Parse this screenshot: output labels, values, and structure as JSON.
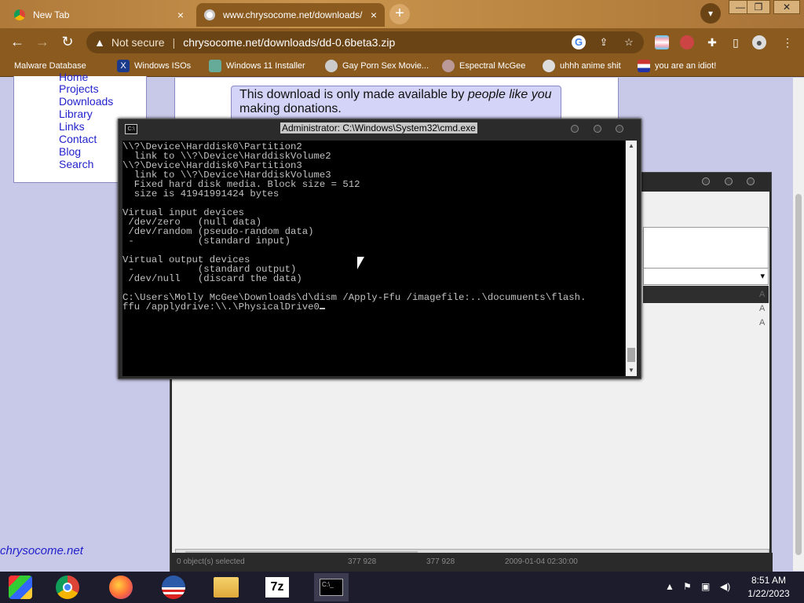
{
  "browser": {
    "tabs": [
      {
        "label": "New Tab",
        "close": "×",
        "active": false
      },
      {
        "label": "www.chrysocome.net/downloads/",
        "close": "×",
        "active": true
      }
    ],
    "new_tab": "+",
    "window_controls": [
      "—",
      "❐",
      "✕"
    ],
    "address": {
      "security_label": "Not secure",
      "url": "chrysocome.net/downloads/dd-0.6beta3.zip"
    },
    "bookmarks": [
      {
        "label": "Malware Database",
        "icon": "globe-icon"
      },
      {
        "label": "Windows ISOs",
        "icon": "x-icon"
      },
      {
        "label": "Windows 11 Installer",
        "icon": "image-icon"
      },
      {
        "label": "Gay Porn Sex Movie...",
        "icon": "avatar-icon"
      },
      {
        "label": "Espectral McGee",
        "icon": "avatar-icon"
      },
      {
        "label": "uhhh anime shit",
        "icon": "avatar-icon"
      },
      {
        "label": "you are an idiot!",
        "icon": "flag-icon"
      }
    ]
  },
  "page": {
    "nav_links": [
      "Home",
      "Projects",
      "Downloads",
      "Library",
      "Links",
      "Contact",
      "Blog",
      "Search"
    ],
    "donation_text_prefix": "This download is only made available by ",
    "donation_text_em": "people like you",
    "donation_text_suffix": "making donations.",
    "site_link": "chrysocome.net"
  },
  "bg_window": {
    "column_letters": [
      "A",
      "A",
      "A"
    ],
    "status_items": [
      "0 object(s) selected",
      "377 928",
      "377 928",
      "2009-01-04 02:30:00"
    ]
  },
  "cmd": {
    "title": "Administrator: C:\\Windows\\System32\\cmd.exe",
    "lines": [
      "\\\\?\\Device\\Harddisk0\\Partition2",
      "  link to \\\\?\\Device\\HarddiskVolume2",
      "\\\\?\\Device\\Harddisk0\\Partition3",
      "  link to \\\\?\\Device\\HarddiskVolume3",
      "  Fixed hard disk media. Block size = 512",
      "  size is 41941991424 bytes",
      "",
      "Virtual input devices",
      " /dev/zero   (null data)",
      " /dev/random (pseudo-random data)",
      " -           (standard input)",
      "",
      "Virtual output devices",
      " -           (standard output)",
      " /dev/null   (discard the data)",
      "",
      "C:\\Users\\Molly McGee\\Downloads\\d\\dism /Apply-Ffu /imagefile:..\\documuents\\flash.",
      "ffu /applydrive:\\\\.\\PhysicalDrive0"
    ]
  },
  "taskbar": {
    "apps": [
      "start",
      "chrome",
      "firefox",
      "obama",
      "explorer",
      "7zip",
      "cmd"
    ],
    "label_7z": "7z",
    "label_cmd": "C:\\_",
    "clock_time": "8:51 AM",
    "clock_date": "1/22/2023"
  },
  "colors": {
    "accent": "#8a5a1e",
    "link": "#2222cc",
    "page_bg": "#c8c8e8"
  }
}
